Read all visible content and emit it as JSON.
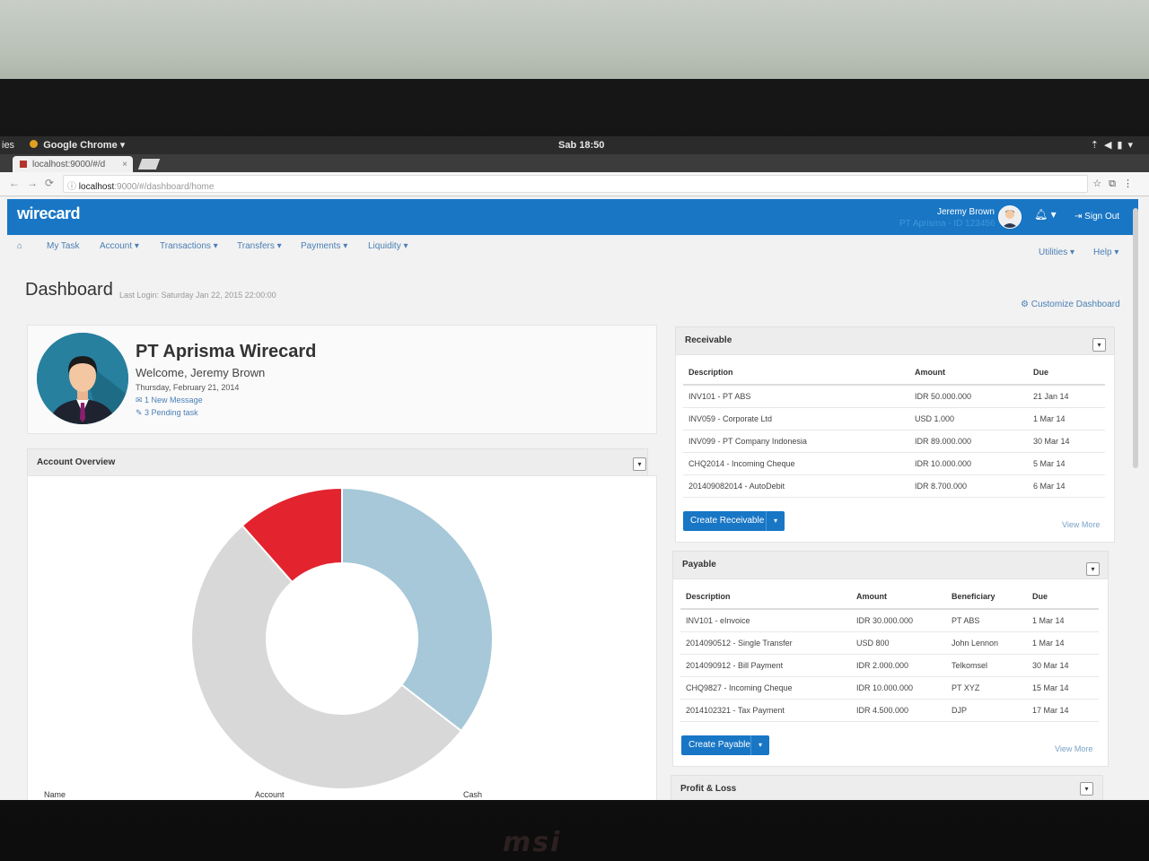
{
  "os": {
    "left_label": "ies",
    "app_menu": "Google Chrome",
    "clock": "Sab 18:50"
  },
  "browser": {
    "tab_title": "localhost:9000/#/d",
    "url_host": "localhost",
    "url_rest": ":9000/#/dashboard/home"
  },
  "header": {
    "brand": "wirecard",
    "user_name": "Jeremy Brown",
    "company_line": "PT Aprisma - ID 123456",
    "sign_out": "Sign Out"
  },
  "menu": {
    "items": [
      "My Task",
      "Account ▾",
      "Transactions ▾",
      "Transfers ▾",
      "Payments ▾",
      "Liquidity ▾"
    ],
    "right_items": [
      "Utilities ▾",
      "Help ▾"
    ]
  },
  "page": {
    "title": "Dashboard",
    "last_login": "Last Login: Saturday Jan 22, 2015 22:00:00",
    "customize": "Customize Dashboard"
  },
  "profile": {
    "company": "PT Aprisma Wirecard",
    "welcome": "Welcome, Jeremy Brown",
    "date": "Thursday, February 21, 2014",
    "messages": "1 New Message",
    "tasks": "3 Pending task"
  },
  "account_overview": {
    "title": "Account Overview",
    "columns": [
      "Name",
      "Account",
      "Cash"
    ]
  },
  "receivable": {
    "title": "Receivable",
    "headers": [
      "Description",
      "Amount",
      "Due"
    ],
    "rows": [
      [
        "INV101 - PT ABS",
        "IDR 50.000.000",
        "21 Jan 14"
      ],
      [
        "INV059 - Corporate Ltd",
        "USD 1.000",
        "1 Mar 14"
      ],
      [
        "INV099 - PT Company Indonesia",
        "IDR 89.000.000",
        "30 Mar 14"
      ],
      [
        "CHQ2014 - Incoming Cheque",
        "IDR 10.000.000",
        "5 Mar 14"
      ],
      [
        "201409082014 - AutoDebit",
        "IDR 8.700.000",
        "6 Mar 14"
      ]
    ],
    "button": "Create Receivable",
    "view_more": "View More"
  },
  "payable": {
    "title": "Payable",
    "headers": [
      "Description",
      "Amount",
      "Beneficiary",
      "Due"
    ],
    "rows": [
      [
        "INV101 - eInvoice",
        "IDR 30.000.000",
        "PT ABS",
        "1 Mar 14"
      ],
      [
        "2014090512 - Single Transfer",
        "USD 800",
        "John Lennon",
        "1 Mar 14"
      ],
      [
        "2014090912 - Bill Payment",
        "IDR 2.000.000",
        "Telkomsel",
        "30 Mar 14"
      ],
      [
        "CHQ9827 - Incoming Cheque",
        "IDR 10.000.000",
        "PT XYZ",
        "15 Mar 14"
      ],
      [
        "2014102321 - Tax Payment",
        "IDR 4.500.000",
        "DJP",
        "17 Mar 14"
      ]
    ],
    "button": "Create Payable",
    "view_more": "View More"
  },
  "profit_loss": {
    "title": "Profit & Loss"
  },
  "donut": {
    "segments": [
      {
        "value": 0.355,
        "color": "#a6c8d8"
      },
      {
        "value": 0.53,
        "color": "#d8d8d8"
      },
      {
        "value": 0.115,
        "color": "#e3232e"
      }
    ]
  },
  "colors": {
    "brand": "#1876c5",
    "link": "#4a7fb5"
  },
  "bottom_logo": "msi"
}
